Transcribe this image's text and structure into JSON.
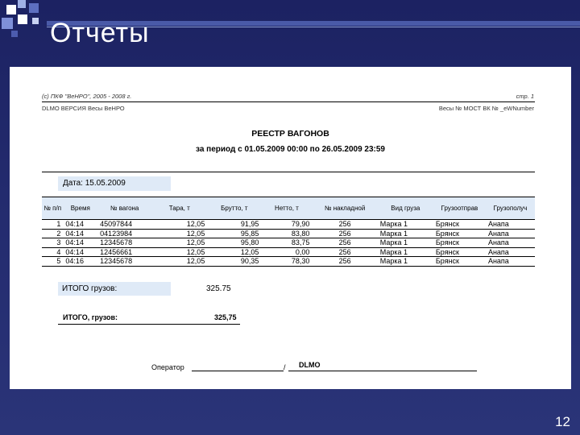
{
  "slide": {
    "title": "Отчеты",
    "page_number": "12",
    "colors": {
      "background": "#1c2262",
      "accent": "#4a5aa8",
      "highlight": "#dfeaf7"
    }
  },
  "report": {
    "copyright": "(с) ПКФ \"ВеНРО\", 2005 - 2008 г.",
    "page_label": "стр. 1",
    "software": "DLMO ВЕРСИЯ Весы ВеНРО",
    "scale": "Весы № МОСТ ВК № _eWNumber",
    "title": "РЕЕСТР ВАГОНОВ",
    "period": "за период с 01.05.2009 00:00 по 26.05.2009 23:59",
    "date_label": "Дата:",
    "date_value": "15.05.2009",
    "columns": [
      "№ п/п",
      "Время",
      "№ вагона",
      "Тара, т",
      "Брутто, т",
      "Нетто, т",
      "№ накладной",
      "Вид груза",
      "Грузоотправ",
      "Грузополуч"
    ],
    "rows": [
      [
        "1",
        "04:14",
        "45097844",
        "12,05",
        "91,95",
        "79,90",
        "256",
        "Марка 1",
        "Брянск",
        "Анапа"
      ],
      [
        "2",
        "04:14",
        "04123984",
        "12,05",
        "95,85",
        "83,80",
        "256",
        "Марка 1",
        "Брянск",
        "Анапа"
      ],
      [
        "3",
        "04:14",
        "12345678",
        "12,05",
        "95,80",
        "83,75",
        "256",
        "Марка 1",
        "Брянск",
        "Анапа"
      ],
      [
        "4",
        "04:14",
        "12456661",
        "12,05",
        "12,05",
        "0,00",
        "256",
        "Марка 1",
        "Брянск",
        "Анапа"
      ],
      [
        "5",
        "04:16",
        "12345678",
        "12,05",
        "90,35",
        "78,30",
        "256",
        "Марка 1",
        "Брянск",
        "Анапа"
      ]
    ],
    "total_label": "ИТОГО грузов:",
    "total_value": "325.75",
    "total2_label": "ИТОГО, грузов:",
    "total2_value": "325,75",
    "operator_label": "Оператор",
    "operator_name": "DLMO"
  }
}
